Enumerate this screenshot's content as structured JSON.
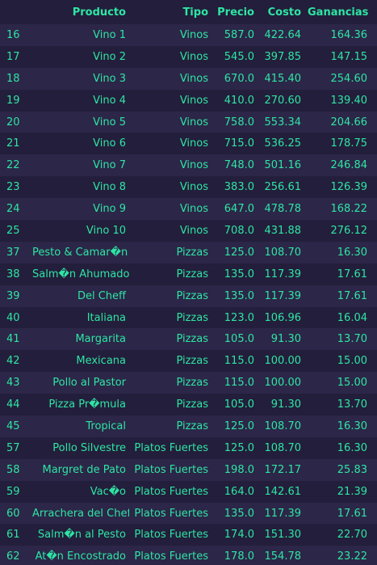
{
  "table": {
    "columns": {
      "index": "",
      "producto": "Producto",
      "tipo": "Tipo",
      "precio": "Precio",
      "costo": "Costo",
      "ganancias": "Ganancias"
    },
    "rows": [
      {
        "index": "16",
        "producto": "Vino 1",
        "tipo": "Vinos",
        "precio": "587.0",
        "costo": "422.64",
        "ganancias": "164.36"
      },
      {
        "index": "17",
        "producto": "Vino 2",
        "tipo": "Vinos",
        "precio": "545.0",
        "costo": "397.85",
        "ganancias": "147.15"
      },
      {
        "index": "18",
        "producto": "Vino 3",
        "tipo": "Vinos",
        "precio": "670.0",
        "costo": "415.40",
        "ganancias": "254.60"
      },
      {
        "index": "19",
        "producto": "Vino 4",
        "tipo": "Vinos",
        "precio": "410.0",
        "costo": "270.60",
        "ganancias": "139.40"
      },
      {
        "index": "20",
        "producto": "Vino 5",
        "tipo": "Vinos",
        "precio": "758.0",
        "costo": "553.34",
        "ganancias": "204.66"
      },
      {
        "index": "21",
        "producto": "Vino 6",
        "tipo": "Vinos",
        "precio": "715.0",
        "costo": "536.25",
        "ganancias": "178.75"
      },
      {
        "index": "22",
        "producto": "Vino 7",
        "tipo": "Vinos",
        "precio": "748.0",
        "costo": "501.16",
        "ganancias": "246.84"
      },
      {
        "index": "23",
        "producto": "Vino 8",
        "tipo": "Vinos",
        "precio": "383.0",
        "costo": "256.61",
        "ganancias": "126.39"
      },
      {
        "index": "24",
        "producto": "Vino 9",
        "tipo": "Vinos",
        "precio": "647.0",
        "costo": "478.78",
        "ganancias": "168.22"
      },
      {
        "index": "25",
        "producto": "Vino 10",
        "tipo": "Vinos",
        "precio": "708.0",
        "costo": "431.88",
        "ganancias": "276.12"
      },
      {
        "index": "37",
        "producto": "Pesto & Camar�n",
        "tipo": "Pizzas",
        "precio": "125.0",
        "costo": "108.70",
        "ganancias": "16.30"
      },
      {
        "index": "38",
        "producto": "Salm�n Ahumado",
        "tipo": "Pizzas",
        "precio": "135.0",
        "costo": "117.39",
        "ganancias": "17.61"
      },
      {
        "index": "39",
        "producto": "Del Cheff",
        "tipo": "Pizzas",
        "precio": "135.0",
        "costo": "117.39",
        "ganancias": "17.61"
      },
      {
        "index": "40",
        "producto": "Italiana",
        "tipo": "Pizzas",
        "precio": "123.0",
        "costo": "106.96",
        "ganancias": "16.04"
      },
      {
        "index": "41",
        "producto": "Margarita",
        "tipo": "Pizzas",
        "precio": "105.0",
        "costo": "91.30",
        "ganancias": "13.70"
      },
      {
        "index": "42",
        "producto": "Mexicana",
        "tipo": "Pizzas",
        "precio": "115.0",
        "costo": "100.00",
        "ganancias": "15.00"
      },
      {
        "index": "43",
        "producto": "Pollo al Pastor",
        "tipo": "Pizzas",
        "precio": "115.0",
        "costo": "100.00",
        "ganancias": "15.00"
      },
      {
        "index": "44",
        "producto": "Pizza Pr�mula",
        "tipo": "Pizzas",
        "precio": "105.0",
        "costo": "91.30",
        "ganancias": "13.70"
      },
      {
        "index": "45",
        "producto": "Tropical",
        "tipo": "Pizzas",
        "precio": "125.0",
        "costo": "108.70",
        "ganancias": "16.30"
      },
      {
        "index": "57",
        "producto": "Pollo Silvestre",
        "tipo": "Platos Fuertes",
        "precio": "125.0",
        "costo": "108.70",
        "ganancias": "16.30"
      },
      {
        "index": "58",
        "producto": "Margret de Pato",
        "tipo": "Platos Fuertes",
        "precio": "198.0",
        "costo": "172.17",
        "ganancias": "25.83"
      },
      {
        "index": "59",
        "producto": "Vac�o",
        "tipo": "Platos Fuertes",
        "precio": "164.0",
        "costo": "142.61",
        "ganancias": "21.39"
      },
      {
        "index": "60",
        "producto": "Arrachera del Chef",
        "tipo": "Platos Fuertes",
        "precio": "135.0",
        "costo": "117.39",
        "ganancias": "17.61"
      },
      {
        "index": "61",
        "producto": "Salm�n al Pesto",
        "tipo": "Platos Fuertes",
        "precio": "174.0",
        "costo": "151.30",
        "ganancias": "22.70"
      },
      {
        "index": "62",
        "producto": "At�n Encostrado",
        "tipo": "Platos Fuertes",
        "precio": "178.0",
        "costo": "154.78",
        "ganancias": "23.22"
      }
    ]
  },
  "colors": {
    "text": "#2ee5a4",
    "row_odd": "#2c2648",
    "row_even": "#231e3b"
  }
}
